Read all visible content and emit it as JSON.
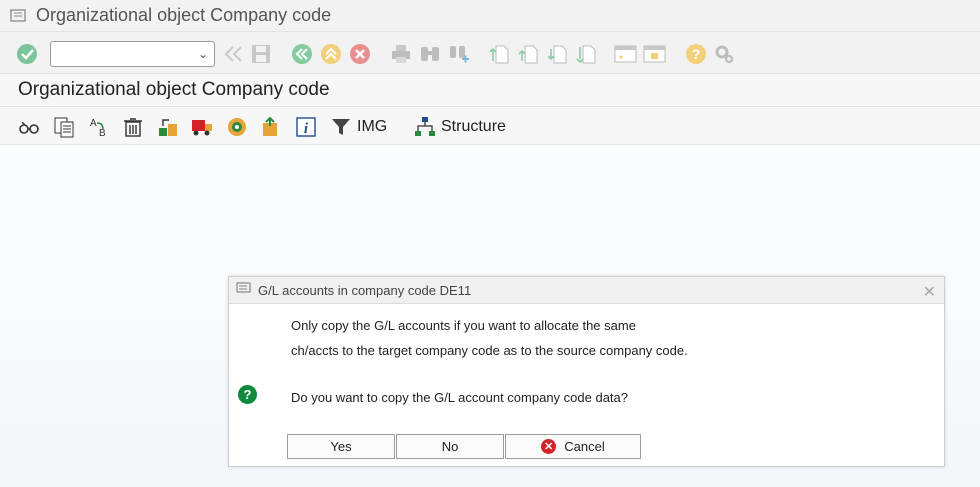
{
  "window": {
    "title": "Organizational object Company code"
  },
  "toolbar": {
    "command_value": ""
  },
  "page": {
    "title": "Organizational object Company code"
  },
  "app_toolbar": {
    "img_label": "IMG",
    "structure_label": "Structure"
  },
  "dialog": {
    "title": "G/L accounts in company code DE11",
    "line1": "Only copy the G/L accounts if you want to allocate the same",
    "line2": "ch/accts to the target company code as to the source company code.",
    "question": "Do you want to copy the G/L account company code data?",
    "yes": "Yes",
    "no": "No",
    "cancel": "Cancel"
  }
}
